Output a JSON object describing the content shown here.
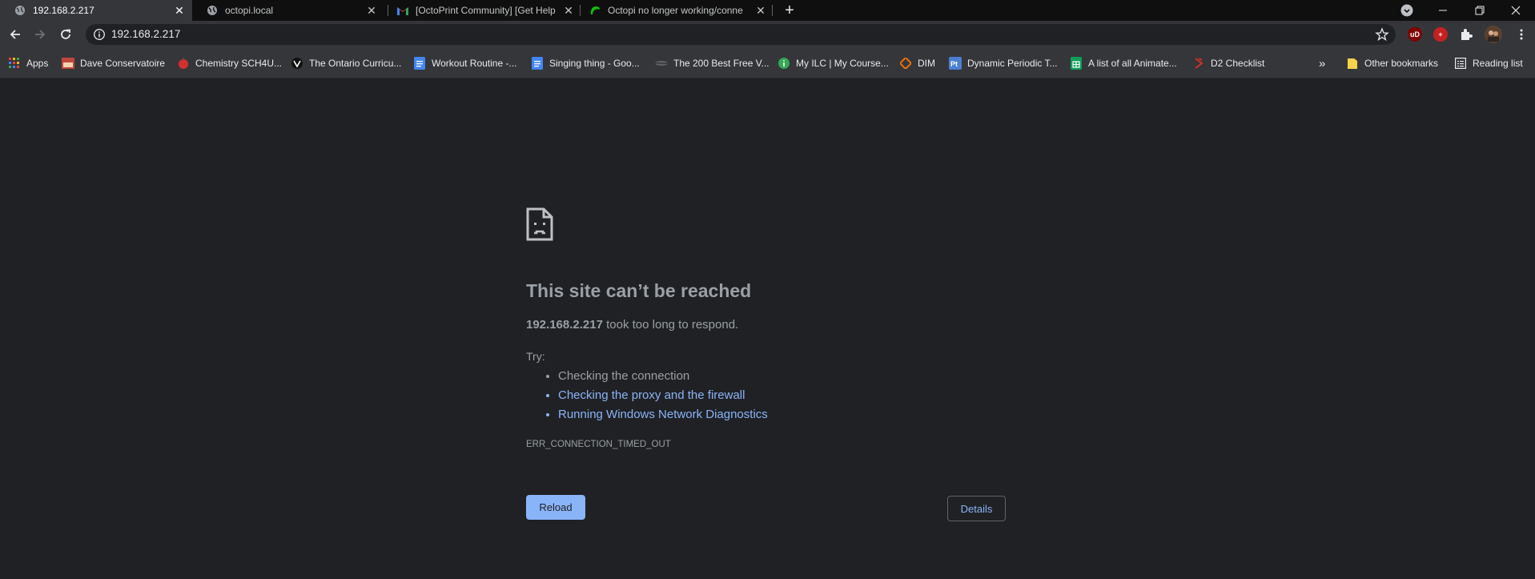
{
  "tabs": [
    {
      "title": "192.168.2.217",
      "icon": "globe-icon",
      "active": true
    },
    {
      "title": "octopi.local",
      "icon": "globe-icon",
      "active": false
    },
    {
      "title": "[OctoPrint Community] [Get Help",
      "icon": "gmail-icon",
      "active": false
    },
    {
      "title": "Octopi no longer working/conne",
      "icon": "octoprint-icon",
      "active": false
    }
  ],
  "toolbar": {
    "url": "192.168.2.217"
  },
  "bookmarks": [
    {
      "label": "Apps",
      "icon": "apps-grid-icon"
    },
    {
      "label": "Dave Conservatoire",
      "icon": "dave-conservatoire-icon"
    },
    {
      "label": "Chemistry SCH4U...",
      "icon": "apple-icon"
    },
    {
      "label": "The Ontario Curricu...",
      "icon": "ontario-icon"
    },
    {
      "label": "Workout Routine -...",
      "icon": "docs-icon"
    },
    {
      "label": "Singing thing - Goo...",
      "icon": "docs-icon"
    },
    {
      "label": "The 200 Best Free V...",
      "icon": "site-icon"
    },
    {
      "label": "My ILC | My Course...",
      "icon": "info-green-icon"
    },
    {
      "label": "DIM",
      "icon": "dim-icon"
    },
    {
      "label": "Dynamic Periodic T...",
      "icon": "ptable-icon"
    },
    {
      "label": "A list of all Animate...",
      "icon": "sheets-icon"
    },
    {
      "label": "D2 Checklist",
      "icon": "d2-icon"
    }
  ],
  "bookmarks_overflow": "»",
  "other_bookmarks": "Other bookmarks",
  "reading_list": "Reading list",
  "error": {
    "title": "This site can’t be reached",
    "host": "192.168.2.217",
    "message": " took too long to respond.",
    "try_label": "Try:",
    "suggestions": [
      "Checking the connection",
      "Checking the proxy and the firewall",
      "Running Windows Network Diagnostics"
    ],
    "code": "ERR_CONNECTION_TIMED_OUT",
    "reload_label": "Reload",
    "details_label": "Details"
  },
  "colors": {
    "background": "#202124",
    "link": "#8ab4f8",
    "text": "#9aa0a6"
  }
}
